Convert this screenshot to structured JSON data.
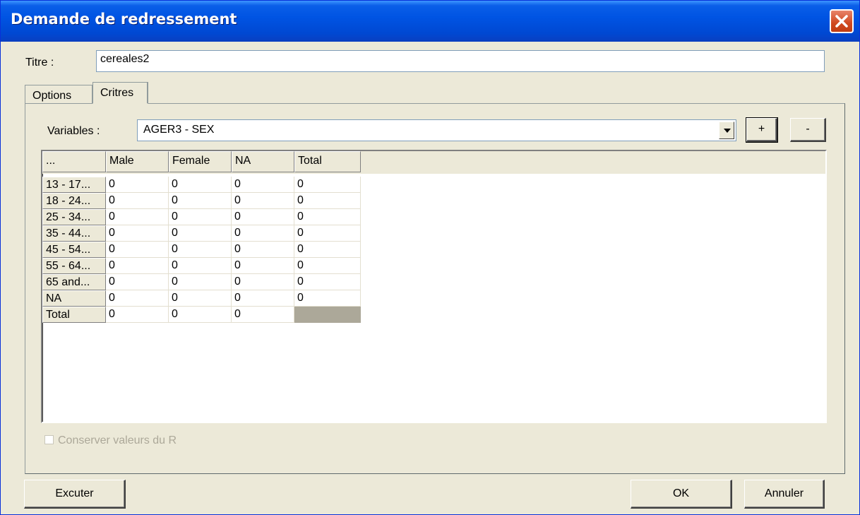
{
  "window": {
    "title": "Demande de redressement"
  },
  "form": {
    "titre_label": "Titre :",
    "titre_value": "cereales2"
  },
  "tabs": [
    {
      "label": "Options",
      "active": false
    },
    {
      "label": "Critres",
      "active": true
    }
  ],
  "critres": {
    "variables_label": "Variables :",
    "variables_value": "AGER3 - SEX",
    "add_label": "+",
    "remove_label": "-",
    "grid": {
      "corner": "...",
      "columns": [
        "Male",
        "Female",
        "NA",
        "Total"
      ],
      "rows": [
        {
          "label": "13 - 17...",
          "values": [
            "0",
            "0",
            "0",
            "0"
          ]
        },
        {
          "label": "18 - 24...",
          "values": [
            "0",
            "0",
            "0",
            "0"
          ]
        },
        {
          "label": "25 - 34...",
          "values": [
            "0",
            "0",
            "0",
            "0"
          ]
        },
        {
          "label": "35 - 44...",
          "values": [
            "0",
            "0",
            "0",
            "0"
          ]
        },
        {
          "label": "45 - 54...",
          "values": [
            "0",
            "0",
            "0",
            "0"
          ]
        },
        {
          "label": "55 - 64...",
          "values": [
            "0",
            "0",
            "0",
            "0"
          ]
        },
        {
          "label": "65 and...",
          "values": [
            "0",
            "0",
            "0",
            "0"
          ]
        },
        {
          "label": "NA",
          "values": [
            "0",
            "0",
            "0",
            "0"
          ]
        },
        {
          "label": "Total",
          "values": [
            "0",
            "0",
            "0",
            ""
          ]
        }
      ]
    },
    "checkbox_label": "Conserver valeurs du R",
    "checkbox_checked": false,
    "checkbox_enabled": false
  },
  "buttons": {
    "execute": "Excuter",
    "ok": "OK",
    "cancel": "Annuler"
  },
  "colors": {
    "titlebar": "#0054e3",
    "face": "#ece9d8",
    "close": "#d0481f"
  }
}
